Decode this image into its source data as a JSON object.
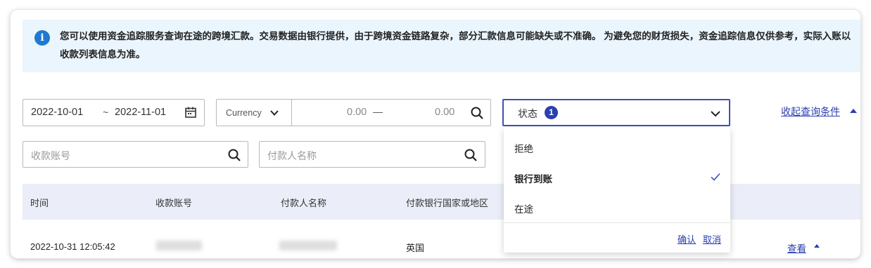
{
  "notice": {
    "icon": "info-icon",
    "icon_glyph": "i",
    "text": "您可以使用资金追踪服务查询在途的跨境汇款。交易数据由银行提供，由于跨境资金链路复杂，部分汇款信息可能缺失或不准确。 为避免您的财货损失，资金追踪信息仅供参考，实际入账以收款列表信息为准。"
  },
  "filters": {
    "date_start": "2022-10-01",
    "date_sep": "~",
    "date_end": "2022-11-01",
    "currency_label": "Currency",
    "amount_min": "0.00",
    "amount_dash": "—",
    "amount_max": "0.00",
    "status_label": "状态",
    "status_count": "1",
    "collapse_label": "收起查询条件",
    "account_placeholder": "收款账号",
    "payer_placeholder": "付款人名称"
  },
  "status_dropdown": {
    "options": [
      {
        "label": "拒绝",
        "selected": false
      },
      {
        "label": "银行到账",
        "selected": true
      },
      {
        "label": "在途",
        "selected": false
      }
    ],
    "confirm_label": "确认",
    "cancel_label": "取消"
  },
  "table": {
    "headers": [
      "时间",
      "收款账号",
      "付款人名称",
      "付款银行国家或地区"
    ],
    "rows": [
      {
        "time": "2022-10-31 12:05:42",
        "country": "英国",
        "action": "查看"
      }
    ]
  },
  "colors": {
    "accent": "#2a3fb0",
    "info_icon": "#1f78d1",
    "notice_bg": "#eaf5fd",
    "table_header_bg": "#ebeef8"
  }
}
